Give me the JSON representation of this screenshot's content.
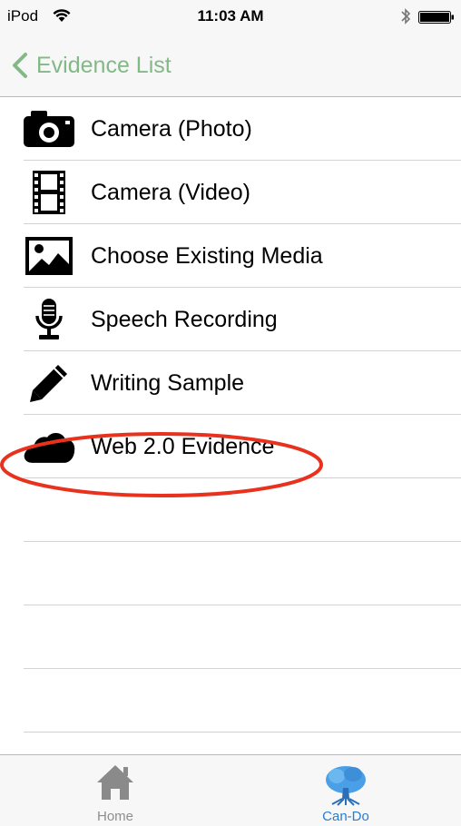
{
  "status_bar": {
    "carrier": "iPod",
    "time": "11:03 AM"
  },
  "nav_bar": {
    "back_label": "Evidence List"
  },
  "menu_items": [
    {
      "label": "Camera (Photo)",
      "icon": "camera-icon"
    },
    {
      "label": "Camera (Video)",
      "icon": "film-strip-icon"
    },
    {
      "label": "Choose Existing Media",
      "icon": "image-icon"
    },
    {
      "label": "Speech Recording",
      "icon": "microphone-icon"
    },
    {
      "label": "Writing Sample",
      "icon": "pencil-icon"
    },
    {
      "label": "Web 2.0 Evidence",
      "icon": "cloud-icon"
    }
  ],
  "highlight": {
    "target": "Web 2.0 Evidence",
    "color": "#e8321e"
  },
  "tab_bar": {
    "tabs": [
      {
        "label": "Home",
        "icon": "house-icon",
        "selected": false
      },
      {
        "label": "Can-Do",
        "icon": "tree-icon",
        "selected": true
      }
    ]
  },
  "colors": {
    "back_tint": "#83b887",
    "selected_tab": "#2a7ccf",
    "unselected_tab": "#8e8e8e"
  }
}
